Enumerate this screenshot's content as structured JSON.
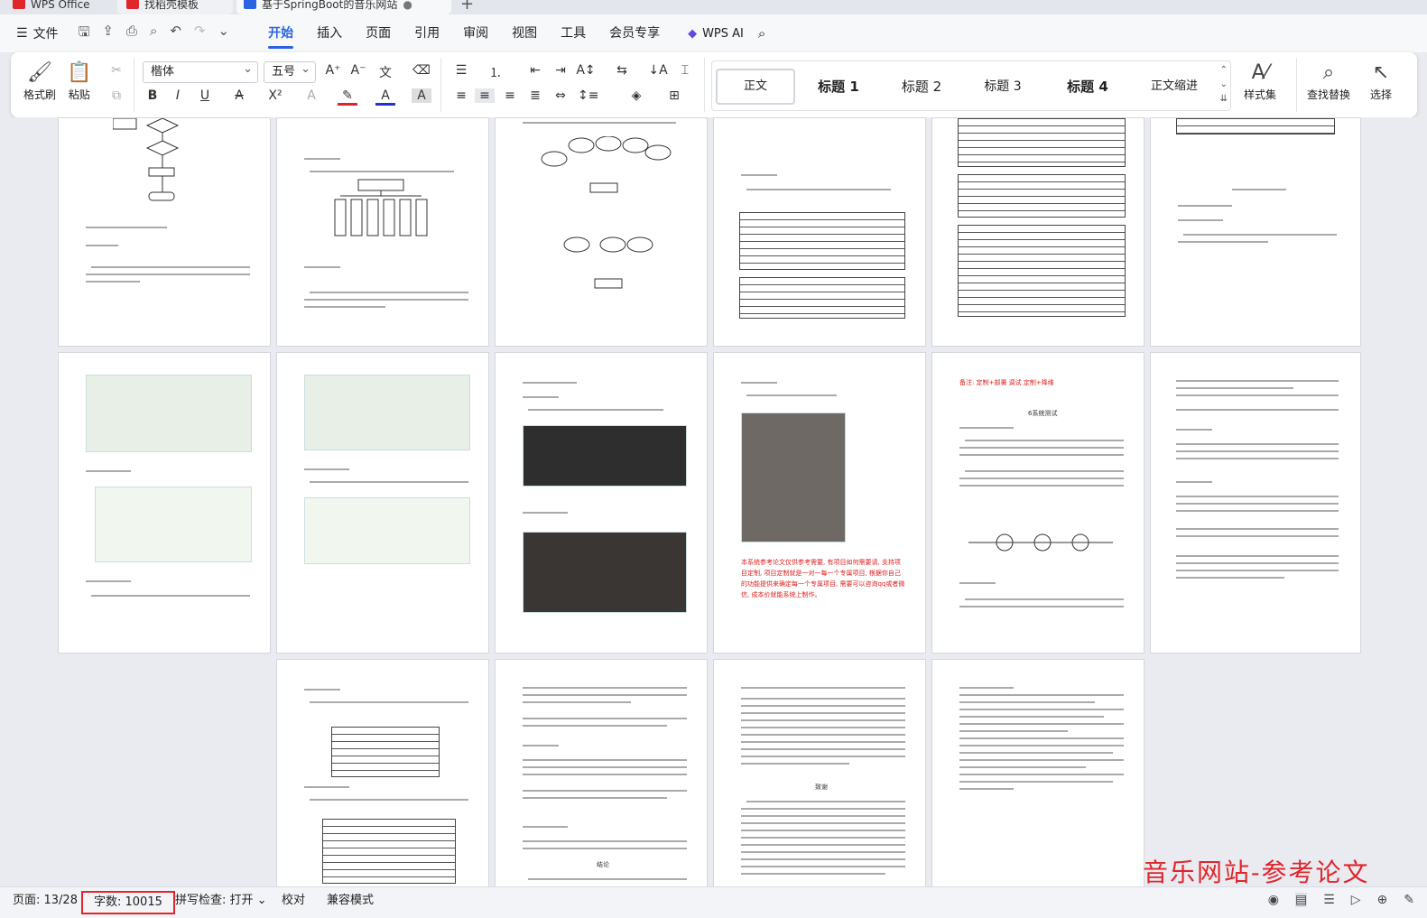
{
  "tabs": {
    "home": "WPS Office",
    "template": "找稻壳模板",
    "document": "基于SpringBoot的音乐网站",
    "add": "+"
  },
  "menu": {
    "file": "文件",
    "tabs": [
      "开始",
      "插入",
      "页面",
      "引用",
      "审阅",
      "视图",
      "工具",
      "会员专享"
    ],
    "active_tab": "开始",
    "wps_ai": "WPS AI"
  },
  "ribbon": {
    "format_painter": "格式刷",
    "paste": "粘贴",
    "font_name": "楷体",
    "font_size": "五号",
    "styles": [
      "正文",
      "标题 1",
      "标题 2",
      "标题 3",
      "标题 4",
      "正文缩进"
    ],
    "style_set": "样式集",
    "find_replace": "查找替换",
    "select": "选择"
  },
  "document_pages": {
    "red_note_top": "备注: 定制+部署 调试 定制+降维",
    "red_note_mid": "本系统参考论文仅供参考需要, 有项目如何需要请, 支持项目定制, 项目定制就是一对一每一个专属项目, 根据你自己的功能提供来确定每一个专属项目, 需要可以咨询qq或者微信, 成本价就能系统上制作。",
    "section_title": "6系统测试",
    "conclusion_title": "结论",
    "thanks_title": "致谢"
  },
  "status": {
    "page": "页面: 13/28",
    "word_count": "字数: 10015",
    "spell_check": "拼写检查: 打开",
    "proof": "校对",
    "compat": "兼容模式"
  },
  "watermark": "音乐网站-参考论文",
  "colors": {
    "accent": "#2b63e0",
    "highlight": "#e0252b"
  }
}
